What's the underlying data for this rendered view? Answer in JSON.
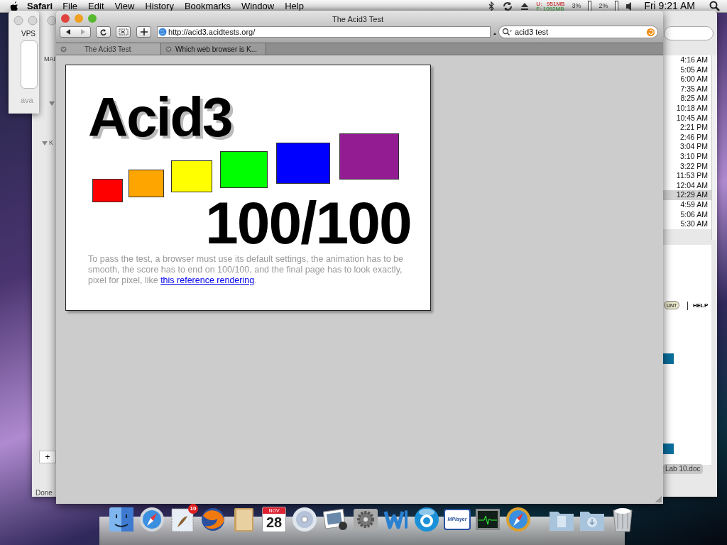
{
  "menu_bar": {
    "app": "Safari",
    "menus": [
      "File",
      "Edit",
      "View",
      "History",
      "Bookmarks",
      "Window",
      "Help"
    ],
    "status": {
      "memory_used": "U:   951MB",
      "memory_free": "F: 1092MB",
      "cpu_one": "3%",
      "cpu_two": "2%",
      "clock": "Fri 9:21 AM"
    }
  },
  "back_windows": {
    "vps_label": "VPS",
    "vps_text": "ava",
    "main_label": "MAI",
    "group_label": "K",
    "status_text": "Done",
    "add_button": "+",
    "times": [
      {
        "text": "4:16 AM",
        "selected": false
      },
      {
        "text": "5:05 AM",
        "selected": false
      },
      {
        "text": "6:00 AM",
        "selected": false
      },
      {
        "text": "7:35 AM",
        "selected": false
      },
      {
        "text": "8:25 AM",
        "selected": false
      },
      {
        "text": "10:18 AM",
        "selected": false
      },
      {
        "text": "10:45 AM",
        "selected": false
      },
      {
        "text": "2:21 PM",
        "selected": false
      },
      {
        "text": "2:46 PM",
        "selected": false
      },
      {
        "text": "3:04 PM",
        "selected": false
      },
      {
        "text": "3:10 PM",
        "selected": false
      },
      {
        "text": "3:22 PM",
        "selected": false
      },
      {
        "text": "11:53 PM",
        "selected": false
      },
      {
        "text": "12:04 AM",
        "selected": false
      },
      {
        "text": "12:29 AM",
        "selected": true
      },
      {
        "text": "4:59 AM",
        "selected": false
      },
      {
        "text": "5:06 AM",
        "selected": false
      },
      {
        "text": "5:30 AM",
        "selected": false
      }
    ],
    "count_button": "UNT",
    "help_link": "HELP",
    "minimized_doc": "Lab 10.doc"
  },
  "browser": {
    "title": "The Acid3 Test",
    "url": "http://acid3.acidtests.org/",
    "search": "acid3 test",
    "tabs": [
      {
        "label": "The Acid3 Test",
        "selected": true
      },
      {
        "label": "Which web browser is K...",
        "selected": false
      }
    ],
    "page": {
      "heading": "Acid3",
      "score": "100/100",
      "boxes": [
        {
          "color": "#ff0000"
        },
        {
          "color": "#ffa500"
        },
        {
          "color": "#ffff00"
        },
        {
          "color": "#00ff00"
        },
        {
          "color": "#0000ff"
        },
        {
          "color": "#931c93"
        }
      ],
      "description": "To pass the test, a browser must use its default settings, the animation has to be smooth, the score has to end on 100/100, and the final page has to look exactly, pixel for pixel, like ",
      "link": "this reference rendering",
      "suffix": "."
    }
  },
  "dock": {
    "items": [
      {
        "kind": "finder"
      },
      {
        "kind": "compass"
      },
      {
        "kind": "mail",
        "badge": "10"
      },
      {
        "kind": "globe"
      },
      {
        "kind": "book"
      },
      {
        "kind": "calendar",
        "month": "NOV",
        "day": "28"
      },
      {
        "kind": "disc"
      },
      {
        "kind": "photo"
      },
      {
        "kind": "gear"
      },
      {
        "kind": "wave"
      },
      {
        "kind": "orb"
      },
      {
        "kind": "player",
        "label": "MPlayer"
      },
      {
        "kind": "monitor"
      },
      {
        "kind": "gold_compass"
      },
      {
        "kind": "folder"
      },
      {
        "kind": "download_folder"
      },
      {
        "kind": "trash"
      }
    ]
  }
}
